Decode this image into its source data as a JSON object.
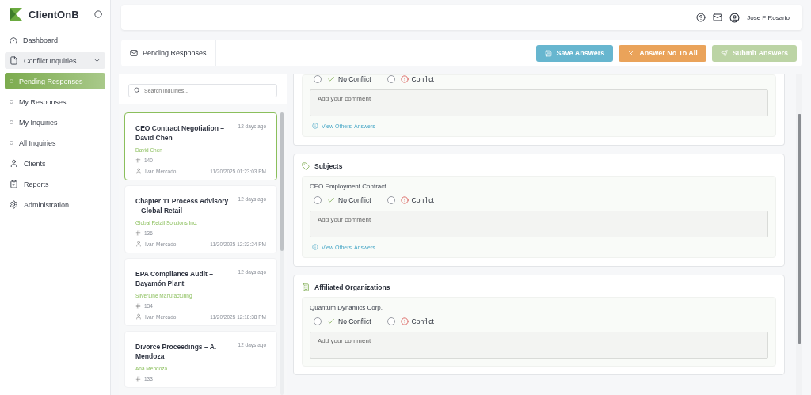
{
  "brand": {
    "name": "ClientOnB"
  },
  "sidebar": {
    "items": [
      {
        "label": "Dashboard",
        "kind": "gauge",
        "selected": false
      },
      {
        "label": "Conflict Inquiries",
        "kind": "file",
        "selected": false,
        "expanded": true,
        "children": [
          {
            "label": "Pending Responses",
            "selected": true
          },
          {
            "label": "My Responses",
            "selected": false
          },
          {
            "label": "My Inquiries",
            "selected": false
          },
          {
            "label": "All Inquiries",
            "selected": false
          }
        ]
      },
      {
        "label": "Clients",
        "kind": "user",
        "selected": false
      },
      {
        "label": "Reports",
        "kind": "report",
        "selected": false
      },
      {
        "label": "Administration",
        "kind": "gear",
        "selected": false
      }
    ]
  },
  "header": {
    "user": "Jose F Rosario"
  },
  "toolbar": {
    "tab": "Pending Responses",
    "buttons": [
      {
        "label": "Save Answers",
        "kind": "save",
        "disabled": false
      },
      {
        "label": "Answer No To All",
        "kind": "none",
        "disabled": false
      },
      {
        "label": "Submit Answers",
        "kind": "submit",
        "disabled": true
      }
    ]
  },
  "inquiries": {
    "search": {
      "placeholder": "Search inquiries..."
    },
    "items": [
      {
        "title": "CEO Contract Negotiation – David Chen",
        "age": "12 days ago",
        "client": "David Chen",
        "number": "140",
        "author": "Ivan Mercado",
        "date": "11/20/2025 01:23:03 PM",
        "selected": true
      },
      {
        "title": "Chapter 11 Process Advisory – Global Retail",
        "age": "12 days ago",
        "client": "Global Retail Solutions Inc.",
        "number": "136",
        "author": "Ivan Mercado",
        "date": "11/20/2025 12:32:24 PM",
        "selected": false
      },
      {
        "title": "EPA Compliance Audit – Bayamón Plant",
        "age": "12 days ago",
        "client": "SilverLine Manufacturing",
        "number": "134",
        "author": "Ivan Mercado",
        "date": "11/20/2025 12:18:38 PM",
        "selected": false
      },
      {
        "title": "Divorce Proceedings – A. Mendoza",
        "age": "12 days ago",
        "client": "Ana Mendoza",
        "number": "133",
        "selected": false
      }
    ]
  },
  "sections": [
    {
      "kind": "cut",
      "entries": [
        {
          "options": [
            {
              "label": "No Conflict",
              "kind": "ok",
              "selected": false
            },
            {
              "label": "Conflict",
              "kind": "conflict",
              "selected": false
            }
          ],
          "comment": {
            "placeholder": "Add your comment"
          },
          "link": "View Others' Answers"
        }
      ]
    },
    {
      "kind": "tag",
      "title": "Subjects",
      "entries": [
        {
          "name": "CEO Employment Contract",
          "options": [
            {
              "label": "No Conflict",
              "kind": "ok",
              "selected": false
            },
            {
              "label": "Conflict",
              "kind": "conflict",
              "selected": false
            }
          ],
          "comment": {
            "placeholder": "Add your comment"
          },
          "link": "View Others' Answers"
        }
      ]
    },
    {
      "kind": "building",
      "title": "Affiliated Organizations",
      "entries": [
        {
          "name": "Quantum Dynamics Corp.",
          "options": [
            {
              "label": "No Conflict",
              "kind": "ok",
              "selected": false
            },
            {
              "label": "Conflict",
              "kind": "conflict",
              "selected": false
            }
          ],
          "comment": {
            "placeholder": "Add your comment"
          }
        }
      ]
    }
  ]
}
